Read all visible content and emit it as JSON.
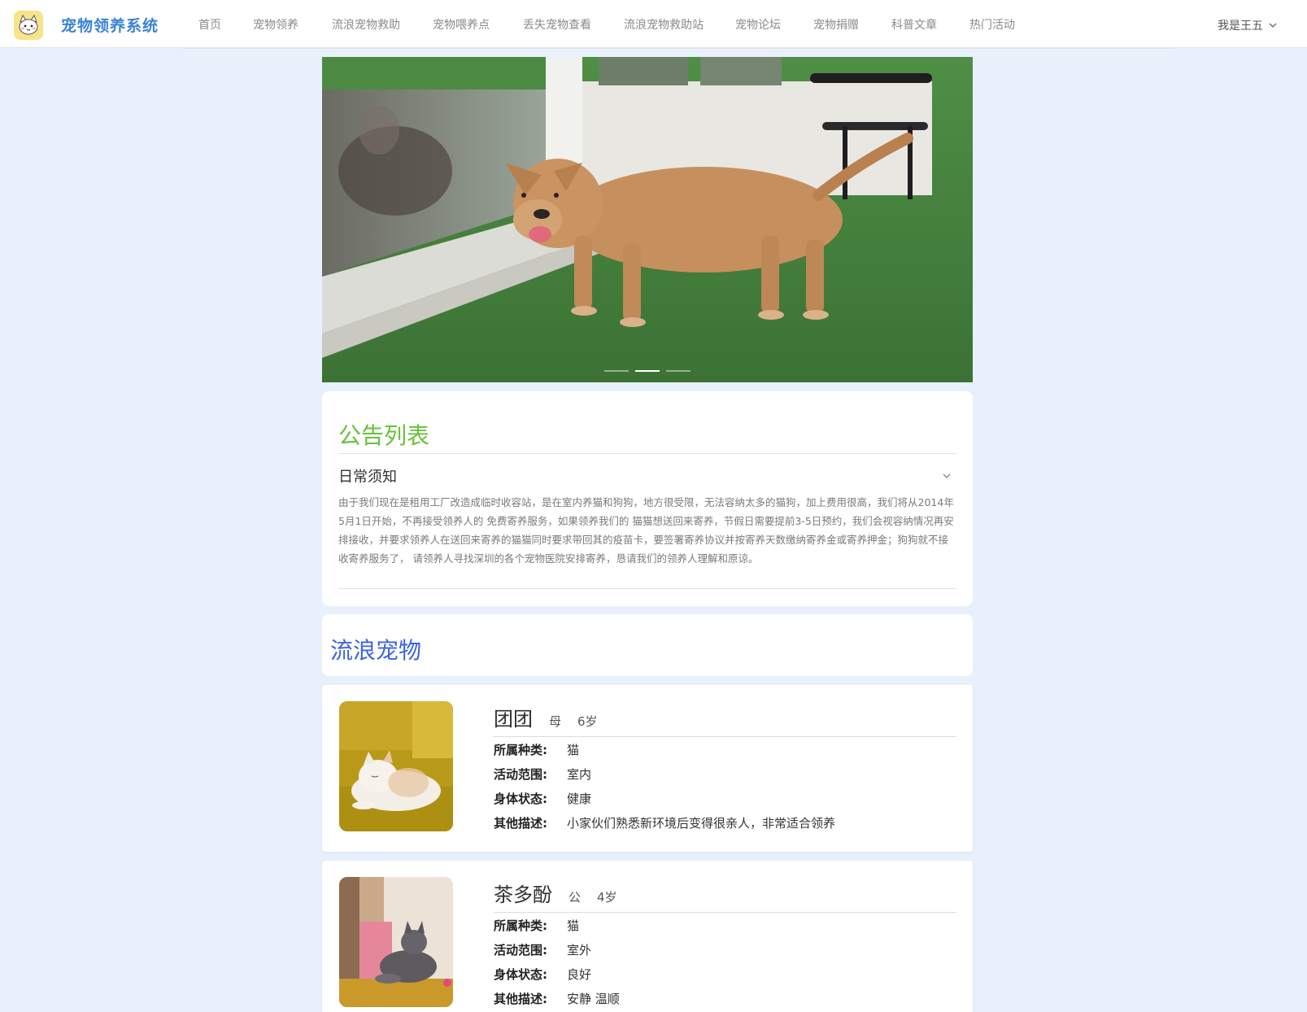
{
  "header": {
    "brand": "宠物领养系统",
    "nav": [
      "首页",
      "宠物领养",
      "流浪宠物救助",
      "宠物喂养点",
      "丢失宠物查看",
      "流浪宠物救助站",
      "宠物论坛",
      "宠物捐赠",
      "科普文章",
      "热门活动"
    ],
    "user": "我是王五"
  },
  "carousel": {
    "slide_count": 3,
    "active_index": 1
  },
  "notice": {
    "title": "公告列表",
    "item_title": "日常须知",
    "item_body": "由于我们现在是租用工厂改造成临时收容站，是在室内养猫和狗狗，地方很受限，无法容纳太多的猫狗，加上费用很高，我们将从2014年5月1日开始，不再接受领养人的 免费寄养服务，如果领养我们的 猫猫想送回来寄养，节假日需要提前3-5日预约，我们会视容纳情况再安排接收，并要求领养人在送回来寄养的猫猫同时要求带回其的疫苗卡，要签署寄养协议并按寄养天数缴纳寄养金或寄养押金；狗狗就不接收寄养服务了， 请领养人寻找深圳的各个宠物医院安排寄养，恳请我们的领养人理解和原谅。"
  },
  "stray": {
    "title": "流浪宠物",
    "labels": {
      "species": "所属种类:",
      "range": "活动范围:",
      "health": "身体状态:",
      "desc": "其他描述:"
    },
    "pets": [
      {
        "name": "团团",
        "sex": "母",
        "age": "6岁",
        "species": "猫",
        "range": "室内",
        "health": "健康",
        "desc": "小家伙们熟悉新环境后变得很亲人，非常适合领养"
      },
      {
        "name": "茶多酚",
        "sex": "公",
        "age": "4岁",
        "species": "猫",
        "range": "室外",
        "health": "良好",
        "desc": "安静 温顺"
      }
    ]
  },
  "colors": {
    "brand": "#3b82d8",
    "notice_title": "#67c23a",
    "stray_title": "#3d63e0",
    "page_bg": "#e8f1fb"
  }
}
